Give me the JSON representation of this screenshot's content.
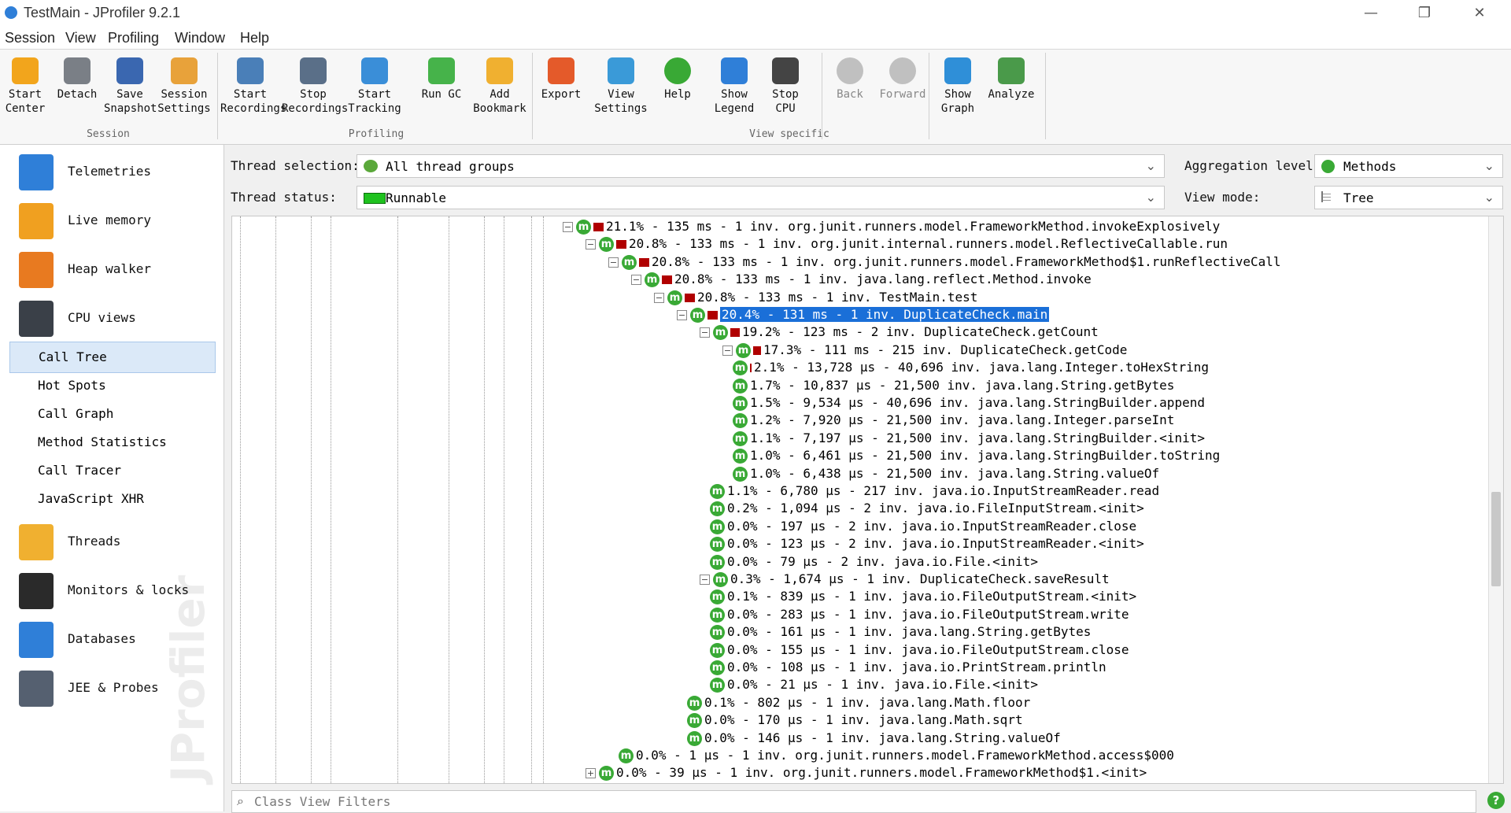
{
  "window": {
    "title": "TestMain - JProfiler 9.2.1",
    "minimize": "—",
    "restore": "❐",
    "close": "✕"
  },
  "menubar": [
    "Session",
    "View",
    "Profiling",
    "Window",
    "Help"
  ],
  "toolbar": {
    "buttons": [
      {
        "label": "Start\nCenter",
        "icon": "start-center-icon",
        "color": "#f2a51c"
      },
      {
        "label": "Detach",
        "icon": "detach-icon",
        "color": "#7a7f86"
      },
      {
        "label": "Save\nSnapshot",
        "icon": "save-icon",
        "color": "#3a67b0"
      },
      {
        "label": "Session\nSettings",
        "icon": "settings-icon",
        "color": "#e8a23a"
      },
      {
        "label": "Start\nRecordings",
        "icon": "start-recordings-icon",
        "color": "#4a7fb8"
      },
      {
        "label": "Stop\nRecordings",
        "icon": "stop-recordings-icon",
        "color": "#5a6f88"
      },
      {
        "label": "Start\nTracking",
        "icon": "tracking-icon",
        "color": "#3a8ed8"
      },
      {
        "label": "Run GC",
        "icon": "run-gc-icon",
        "color": "#46b34a"
      },
      {
        "label": "Add\nBookmark",
        "icon": "bookmark-icon",
        "color": "#f0b030"
      },
      {
        "label": "Export",
        "icon": "export-icon",
        "color": "#e45a2a"
      },
      {
        "label": "View\nSettings",
        "icon": "view-settings-icon",
        "color": "#3a9ad8"
      },
      {
        "label": "Help",
        "icon": "help-icon",
        "color": "#39a935"
      },
      {
        "label": "Show\nLegend",
        "icon": "legend-icon",
        "color": "#2f7fd8"
      },
      {
        "label": "Stop\nCPU",
        "icon": "stop-cpu-icon",
        "color": "#444"
      },
      {
        "label": "Back",
        "icon": "back-icon",
        "color": "#c0c0c0"
      },
      {
        "label": "Forward",
        "icon": "forward-icon",
        "color": "#c0c0c0"
      },
      {
        "label": "Show\nGraph",
        "icon": "graph-icon",
        "color": "#2f8fd8"
      },
      {
        "label": "Analyze",
        "icon": "analyze-icon",
        "color": "#4a9a4a"
      }
    ],
    "groups": [
      "Session",
      "Profiling",
      "View specific"
    ]
  },
  "sidebar": {
    "sections": [
      {
        "label": "Telemetries",
        "icon": "telemetries-icon",
        "color": "#2f7fd8"
      },
      {
        "label": "Live memory",
        "icon": "live-memory-icon",
        "color": "#f0a020"
      },
      {
        "label": "Heap walker",
        "icon": "heap-walker-icon",
        "color": "#e87a20"
      },
      {
        "label": "CPU views",
        "icon": "cpu-views-icon",
        "color": "#3a4048"
      },
      {
        "label": "Threads",
        "icon": "threads-icon",
        "color": "#f0b030"
      },
      {
        "label": "Monitors & locks",
        "icon": "monitors-locks-icon",
        "color": "#2a2a2a"
      },
      {
        "label": "Databases",
        "icon": "databases-icon",
        "color": "#2f7fd8"
      },
      {
        "label": "JEE & Probes",
        "icon": "jee-probes-icon",
        "color": "#556070"
      }
    ],
    "cpu_views": [
      "Call Tree",
      "Hot Spots",
      "Call Graph",
      "Method Statistics",
      "Call Tracer",
      "JavaScript XHR"
    ],
    "selected": "Call Tree",
    "watermark": "JProfiler"
  },
  "filters": {
    "thread_selection_label": "Thread selection:",
    "thread_selection": "All thread groups",
    "thread_status_label": "Thread status:",
    "thread_status": "Runnable",
    "aggregation_label": "Aggregation level:",
    "aggregation": "Methods",
    "view_mode_label": "View mode:",
    "view_mode": "Tree"
  },
  "tree": [
    {
      "depth": 0,
      "exp": "−",
      "bar": 13,
      "text": "21.1% - 135 ms - 1 inv. org.junit.runners.model.FrameworkMethod.invokeExplosively"
    },
    {
      "depth": 1,
      "exp": "−",
      "bar": 13,
      "text": "20.8% - 133 ms - 1 inv. org.junit.internal.runners.model.ReflectiveCallable.run"
    },
    {
      "depth": 2,
      "exp": "−",
      "bar": 13,
      "text": "20.8% - 133 ms - 1 inv. org.junit.runners.model.FrameworkMethod$1.runReflectiveCall"
    },
    {
      "depth": 3,
      "exp": "−",
      "bar": 13,
      "text": "20.8% - 133 ms - 1 inv. java.lang.reflect.Method.invoke"
    },
    {
      "depth": 4,
      "exp": "−",
      "bar": 13,
      "text": "20.8% - 133 ms - 1 inv. TestMain.test"
    },
    {
      "depth": 5,
      "exp": "−",
      "bar": 13,
      "text": "20.4% - 131 ms - 1 inv. DuplicateCheck.main",
      "selected": true
    },
    {
      "depth": 6,
      "exp": "−",
      "bar": 12,
      "text": "19.2% - 123 ms - 2 inv. DuplicateCheck.getCount"
    },
    {
      "depth": 7,
      "exp": "−",
      "bar": 10,
      "text": "17.3% - 111 ms - 215 inv. DuplicateCheck.getCode"
    },
    {
      "depth": 8,
      "exp": "",
      "bar": 2,
      "text": "2.1% - 13,728 μs - 40,696 inv. java.lang.Integer.toHexString"
    },
    {
      "depth": 8,
      "exp": "",
      "bar": 0,
      "text": "1.7% - 10,837 μs - 21,500 inv. java.lang.String.getBytes"
    },
    {
      "depth": 8,
      "exp": "",
      "bar": 0,
      "text": "1.5% - 9,534 μs - 40,696 inv. java.lang.StringBuilder.append"
    },
    {
      "depth": 8,
      "exp": "",
      "bar": 0,
      "text": "1.2% - 7,920 μs - 21,500 inv. java.lang.Integer.parseInt"
    },
    {
      "depth": 8,
      "exp": "",
      "bar": 0,
      "text": "1.1% - 7,197 μs - 21,500 inv. java.lang.StringBuilder.<init>"
    },
    {
      "depth": 8,
      "exp": "",
      "bar": 0,
      "text": "1.0% - 6,461 μs - 21,500 inv. java.lang.StringBuilder.toString"
    },
    {
      "depth": 8,
      "exp": "",
      "bar": 0,
      "text": "1.0% - 6,438 μs - 21,500 inv. java.lang.String.valueOf"
    },
    {
      "depth": 7,
      "exp": "",
      "bar": 0,
      "text": "1.1% - 6,780 μs - 217 inv. java.io.InputStreamReader.read"
    },
    {
      "depth": 7,
      "exp": "",
      "bar": 0,
      "text": "0.2% - 1,094 μs - 2 inv. java.io.FileInputStream.<init>"
    },
    {
      "depth": 7,
      "exp": "",
      "bar": 0,
      "text": "0.0% - 197 μs - 2 inv. java.io.InputStreamReader.close"
    },
    {
      "depth": 7,
      "exp": "",
      "bar": 0,
      "text": "0.0% - 123 μs - 2 inv. java.io.InputStreamReader.<init>"
    },
    {
      "depth": 7,
      "exp": "",
      "bar": 0,
      "text": "0.0% - 79 μs - 2 inv. java.io.File.<init>"
    },
    {
      "depth": 6,
      "exp": "−",
      "bar": 0,
      "text": "0.3% - 1,674 μs - 1 inv. DuplicateCheck.saveResult"
    },
    {
      "depth": 7,
      "exp": "",
      "bar": 0,
      "text": "0.1% - 839 μs - 1 inv. java.io.FileOutputStream.<init>"
    },
    {
      "depth": 7,
      "exp": "",
      "bar": 0,
      "text": "0.0% - 283 μs - 1 inv. java.io.FileOutputStream.write"
    },
    {
      "depth": 7,
      "exp": "",
      "bar": 0,
      "text": "0.0% - 161 μs - 1 inv. java.lang.String.getBytes"
    },
    {
      "depth": 7,
      "exp": "",
      "bar": 0,
      "text": "0.0% - 155 μs - 1 inv. java.io.FileOutputStream.close"
    },
    {
      "depth": 7,
      "exp": "",
      "bar": 0,
      "text": "0.0% - 108 μs - 1 inv. java.io.PrintStream.println"
    },
    {
      "depth": 7,
      "exp": "",
      "bar": 0,
      "text": "0.0% - 21 μs - 1 inv. java.io.File.<init>"
    },
    {
      "depth": 6,
      "exp": "",
      "bar": 0,
      "text": "0.1% - 802 μs - 1 inv. java.lang.Math.floor"
    },
    {
      "depth": 6,
      "exp": "",
      "bar": 0,
      "text": "0.0% - 170 μs - 1 inv. java.lang.Math.sqrt"
    },
    {
      "depth": 6,
      "exp": "",
      "bar": 0,
      "text": "0.0% - 146 μs - 1 inv. java.lang.String.valueOf"
    },
    {
      "depth": 3,
      "exp": "",
      "bar": 0,
      "text": "0.0% - 1 μs - 1 inv. org.junit.runners.model.FrameworkMethod.access$000"
    },
    {
      "depth": 1,
      "exp": "+",
      "bar": 0,
      "text": "0.0% - 39 μs - 1 inv. org.junit.runners.model.FrameworkMethod$1.<init>"
    }
  ],
  "filter_placeholder": "Class View Filters",
  "help_glyph": "?"
}
